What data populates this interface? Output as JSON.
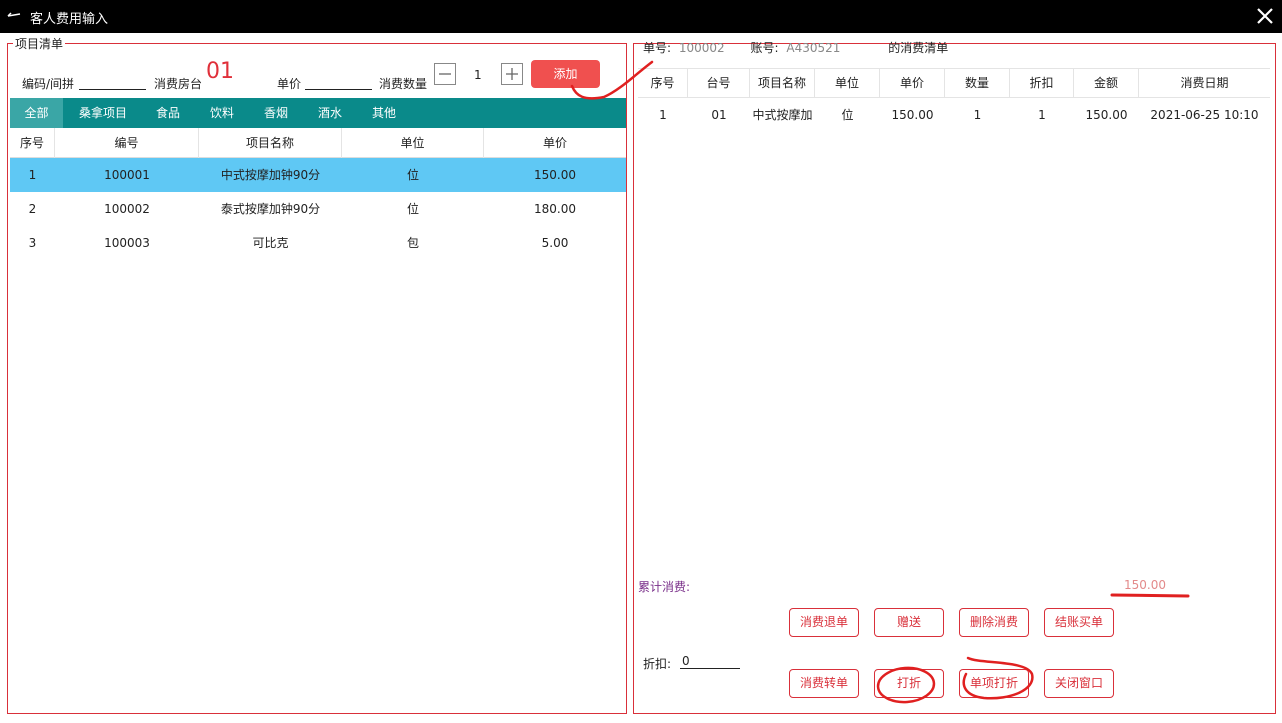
{
  "window": {
    "title": "客人费用输入",
    "back_icon": "back-arrow-icon",
    "close_icon": "close-icon"
  },
  "left": {
    "group_title": "项目清单",
    "code_label": "编码/间拼",
    "room_label": "消费房台",
    "room_value": "01",
    "price_label": "单价",
    "qty_label": "消费数量",
    "qty_value": "1",
    "add_label": "添加",
    "tabs": [
      {
        "label": "全部",
        "active": true
      },
      {
        "label": "桑拿项目"
      },
      {
        "label": "食品"
      },
      {
        "label": "饮料"
      },
      {
        "label": "香烟"
      },
      {
        "label": "酒水"
      },
      {
        "label": "其他"
      }
    ],
    "columns": [
      "序号",
      "编号",
      "项目名称",
      "单位",
      "单价"
    ],
    "rows": [
      [
        "1",
        "100001",
        "中式按摩加钟90分",
        "位",
        "150.00"
      ],
      [
        "2",
        "100002",
        "泰式按摩加钟90分",
        "位",
        "180.00"
      ],
      [
        "3",
        "100003",
        "可比克",
        "包",
        "5.00"
      ]
    ]
  },
  "right": {
    "bill_no_label": "单号:",
    "bill_no": "100002",
    "account_label": "账号:",
    "account": "A430521",
    "list_title": "的消费清单",
    "columns": [
      "序号",
      "台号",
      "项目名称",
      "单位",
      "单价",
      "数量",
      "折扣",
      "金额",
      "消费日期"
    ],
    "rows": [
      [
        "1",
        "01",
        "中式按摩加",
        "位",
        "150.00",
        "1",
        "1",
        "150.00",
        "2021-06-25 10:10"
      ]
    ],
    "total_label": "累计消费:",
    "total_value": "150.00",
    "discount_label": "折扣:",
    "discount_value": "0",
    "buttons_row1": [
      "消费退单",
      "赠送",
      "删除消费",
      "结账买单"
    ],
    "buttons_row2": [
      "消费转单",
      "打折",
      "单项打折",
      "关闭窗口"
    ]
  },
  "colors": {
    "accent_red": "#d9303a",
    "tab_bg": "#0a8a8a",
    "row_selected": "#5fc8f4",
    "add_button": "#f0504f"
  }
}
